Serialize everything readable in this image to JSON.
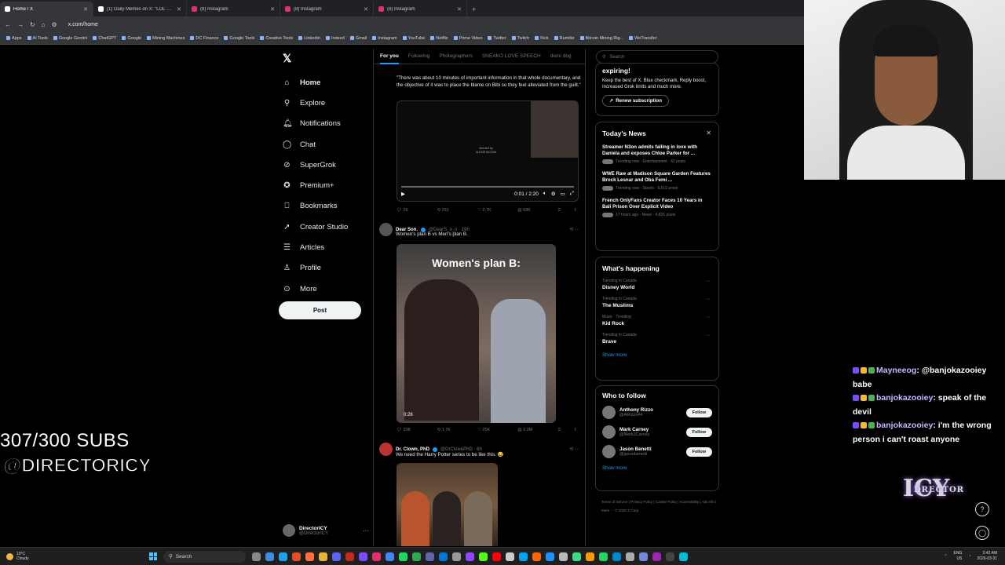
{
  "browser": {
    "tabs": [
      {
        "label": "Home / X",
        "active": true,
        "color": "#ffffff"
      },
      {
        "label": "(1) Daily Memes on X: \"LOL https\"",
        "active": false,
        "color": "#ffffff"
      },
      {
        "label": "(8) Instagram",
        "active": false,
        "color": "#e1306c"
      },
      {
        "label": "(8) Instagram",
        "active": false,
        "color": "#e1306c"
      },
      {
        "label": "(8) Instagram",
        "active": false,
        "color": "#e1306c"
      }
    ],
    "new_tab": "+",
    "url": "x.com/home",
    "bookmarks": [
      "Apps",
      "Ai Tools",
      "Google Gemini",
      "ChatGPT",
      "Google",
      "Mining Machines",
      "DC Finance",
      "Google Tools",
      "Creative Tools",
      "LinkedIn",
      "Indeed",
      "Gmail",
      "Instagram",
      "YouTube",
      "Netflix",
      "Prime Video",
      "Twitter",
      "Twitch",
      "Kick",
      "Rumble",
      "Bitcoin Mining Rig...",
      "WeTransfer"
    ]
  },
  "nav": {
    "items": [
      {
        "label": "Home",
        "icon": "home-icon",
        "glyph": "⌂"
      },
      {
        "label": "Explore",
        "icon": "search-icon",
        "glyph": "⚲"
      },
      {
        "label": "Notifications",
        "icon": "bell-icon",
        "glyph": "🔔︎"
      },
      {
        "label": "Chat",
        "icon": "chat-icon",
        "glyph": "◯"
      },
      {
        "label": "SuperGrok",
        "icon": "grok-icon",
        "glyph": "⊘"
      },
      {
        "label": "Premium+",
        "icon": "premium-icon",
        "glyph": "✪"
      },
      {
        "label": "Bookmarks",
        "icon": "bookmark-icon",
        "glyph": "⎕"
      },
      {
        "label": "Creator Studio",
        "icon": "rocket-icon",
        "glyph": "➚"
      },
      {
        "label": "Articles",
        "icon": "article-icon",
        "glyph": "☰"
      },
      {
        "label": "Profile",
        "icon": "profile-icon",
        "glyph": "♙"
      },
      {
        "label": "More",
        "icon": "more-icon",
        "glyph": "⊙"
      }
    ],
    "post_label": "Post",
    "account": {
      "name": "DirectorICY",
      "handle": "@DirectorICY"
    }
  },
  "feed": {
    "tabs": [
      "For you",
      "Following",
      "Photographers",
      "SNEAKO LOVE SPEECH",
      "demi dog"
    ],
    "post1": {
      "quote": "\"There was about 10 minutes of important information in that whole documentary, and the objective of it was to place the blame on Bibi so they feel alleviated from the guilt.\"",
      "credit": "directed by\nALEXIS BLOOM",
      "time": "0:01 / 2:20",
      "actions": [
        "26",
        "291",
        "2.7K",
        "68K"
      ]
    },
    "post2": {
      "name": "Dear Son.",
      "handle": "@DearS_o_n · 19h",
      "text": "Women's plan B vs Men's plan B.",
      "caption": "Women's plan B:",
      "duration": "0:26",
      "actions": [
        "238",
        "1.7K",
        "25K",
        "2.2M"
      ]
    },
    "post3": {
      "name": "Dr. Clown, PhD",
      "handle": "@DrClownPhD · 6h",
      "text": "We need the Harry Potter series to be like this. 😂"
    }
  },
  "right": {
    "search_placeholder": "Search",
    "premium": {
      "title": "expiring!",
      "body": "Keep the best of X. Blue checkmark, Reply boost, Increased Grok limits and much more.",
      "button": "Renew subscription"
    },
    "news": {
      "title": "Today's News",
      "items": [
        {
          "title": "Streamer N3on admits falling in love with Daniela and exposes Chloe Parker for ...",
          "meta": "Trending now · Entertainment · 42 posts"
        },
        {
          "title": "WWE Raw at Madison Square Garden Features Brock Lesnar and Oba Femi ...",
          "meta": "Trending now · Sports · 5,519 posts"
        },
        {
          "title": "French OnlyFans Creator Faces 10 Years in Bali Prison Over Explicit Video",
          "meta": "17 hours ago · News · 4,826 posts"
        }
      ]
    },
    "happening": {
      "title": "What's happening",
      "trends": [
        {
          "context": "Trending in Canada",
          "name": "Disney World"
        },
        {
          "context": "Trending in Canada",
          "name": "The Muslims"
        },
        {
          "context": "Music · Trending",
          "name": "Kid Rock"
        },
        {
          "context": "Trending in Canada",
          "name": "Brave"
        }
      ],
      "show_more": "Show more"
    },
    "follow": {
      "title": "Who to follow",
      "users": [
        {
          "name": "Anthony Rizzo",
          "handle": "@ARizzo44"
        },
        {
          "name": "Mark Carney",
          "handle": "@MarkJCarney"
        },
        {
          "name": "Jason Benetti",
          "handle": "@jasonbenetti"
        }
      ],
      "button": "Follow",
      "show_more": "Show more"
    },
    "footer": "Terms of Service | Privacy Policy | Cookie Policy | Accessibility | Ads info | More ··· © 2026 X Corp."
  },
  "overlay": {
    "subs": "307/300 SUBS",
    "handle": "@DIRECTORICY",
    "chat": [
      {
        "user": "Mayneeog",
        "msg": ": @banjokazooiey babe"
      },
      {
        "user": "banjokazooiey",
        "msg": ": speak of the devil"
      },
      {
        "user": "banjokazooiey",
        "msg": ": i'm the wrong person i can't roast anyone"
      }
    ],
    "logo_small": "DRECTOR",
    "logo_big": "ICY"
  },
  "taskbar": {
    "weather_temp": "10°C",
    "weather_desc": "Cloudy",
    "search": "Search",
    "lang1": "ENG",
    "lang2": "US",
    "time": "2:42 AM",
    "date": "2026-03-31"
  }
}
